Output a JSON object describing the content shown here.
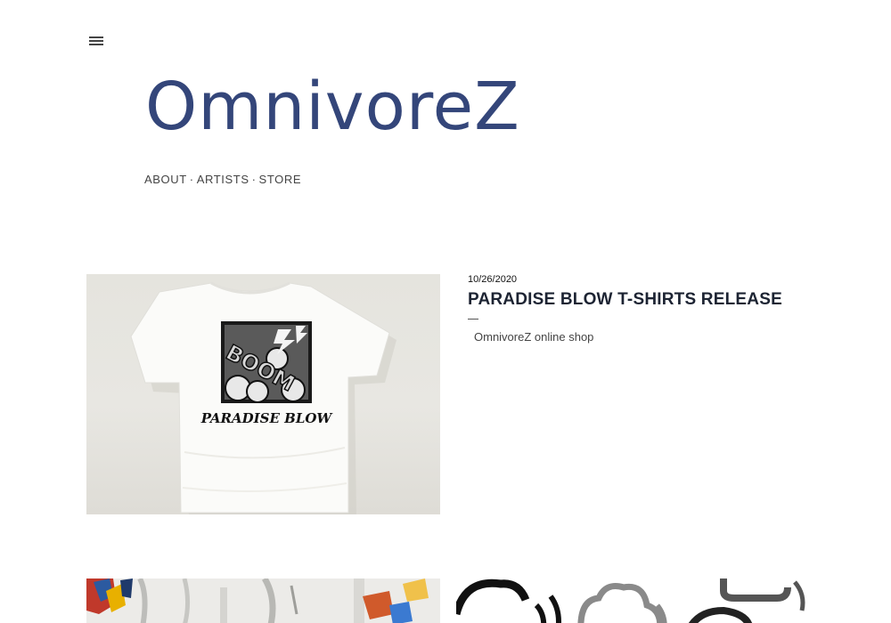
{
  "header": {
    "logo_text": "OmnivoreZ",
    "logo_color": "#34467a"
  },
  "nav": {
    "items": [
      {
        "label": "ABOUT"
      },
      {
        "label": "ARTISTS"
      },
      {
        "label": "STORE"
      }
    ],
    "separator": "·"
  },
  "post": {
    "date": "10/26/2020",
    "title": "PARADISE BLOW T-SHIRTS RELEASE",
    "excerpt": "OmnivoreZ online shop",
    "image": {
      "shirt_text": "PARADISE BLOW",
      "graphic_text": "BOOM"
    }
  },
  "icons": {
    "menu": "hamburger-menu-icon"
  }
}
